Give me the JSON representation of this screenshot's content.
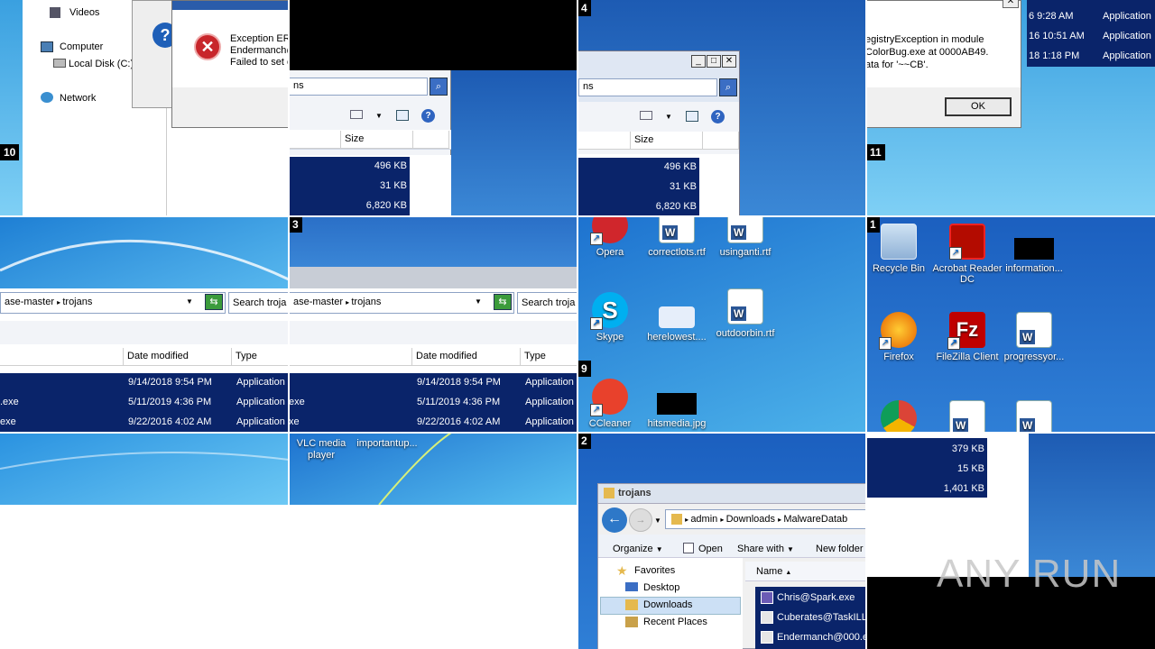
{
  "tile10": {
    "number": "10",
    "nav": [
      "Videos",
      "Computer",
      "Local Disk (C:)",
      "Network"
    ],
    "error_lines": [
      "Exception ER",
      "Endermanch@",
      "Failed to set c"
    ]
  },
  "tile_top2": {
    "search_suffix": "ns",
    "size_header": "Size",
    "sizes": [
      "496 KB",
      "31 KB",
      "6,820 KB"
    ]
  },
  "tile4": {
    "number": "4",
    "search_suffix": "ns",
    "size_header": "Size",
    "sizes": [
      "496 KB",
      "31 KB",
      "6,820 KB"
    ]
  },
  "tile11": {
    "number": "11",
    "lines": [
      "egistryException in module",
      "ColorBug.exe at 0000AB49.",
      "ata for '~~CB'."
    ],
    "ok": "OK",
    "times": [
      "6 9:28 AM",
      "16 10:51 AM",
      "18 1:18 PM"
    ],
    "types": [
      "Application",
      "Application",
      "Application"
    ]
  },
  "explorer": {
    "crumb1": "ase-master",
    "crumb2": "trojans",
    "search": "Search troja",
    "col_date": "Date modified",
    "col_type": "Type",
    "rows": [
      {
        "name": "",
        "date": "9/14/2018 9:54 PM",
        "type": "Application"
      },
      {
        "name": ".exe",
        "date": "5/11/2019 4:36 PM",
        "type": "Application"
      },
      {
        "name": "exe",
        "date": "9/22/2016 4:02 AM",
        "type": "Application"
      }
    ]
  },
  "explorer3": {
    "number": "3",
    "crumb1": "ase-master",
    "crumb2": "trojans",
    "search": "Search troja",
    "col_date": "Date modified",
    "col_type": "Type",
    "rows": [
      {
        "name": "",
        "date": "9/14/2018 9:54 PM",
        "type": "Application"
      },
      {
        "name": "exe",
        "date": "5/11/2019 4:36 PM",
        "type": "Application"
      },
      {
        "name": "xe",
        "date": "9/22/2016 4:02 AM",
        "type": "Application"
      }
    ]
  },
  "tile9": {
    "number": "9",
    "icons": [
      "Opera",
      "correctlots.rtf",
      "usinganti.rtf",
      "Skype",
      "herelowest....",
      "outdoorbin.rtf",
      "CCleaner",
      "hitsmedia.jpg"
    ]
  },
  "tile1": {
    "number": "1",
    "icons": [
      "Recycle Bin",
      "Acrobat Reader DC",
      "information...",
      "Firefox",
      "FileZilla Client",
      "progressyor..."
    ]
  },
  "tile_b2": {
    "icons": [
      "VLC media player",
      "importantup..."
    ]
  },
  "tile2": {
    "number": "2",
    "title": "trojans",
    "address": [
      "admin",
      "Downloads",
      "MalwareDatab"
    ],
    "toolbar": [
      "Organize",
      "Open",
      "Share with",
      "New folder"
    ],
    "nav": [
      "Favorites",
      "Desktop",
      "Downloads",
      "Recent Places"
    ],
    "name_header": "Name",
    "files": [
      "Chris@Spark.exe",
      "Cuberates@TaskILL",
      "Endermanch@000.e"
    ]
  },
  "tile_last": {
    "sizes": [
      "379 KB",
      "15 KB",
      "1,401 KB"
    ]
  },
  "watermark": "ANY RUN"
}
